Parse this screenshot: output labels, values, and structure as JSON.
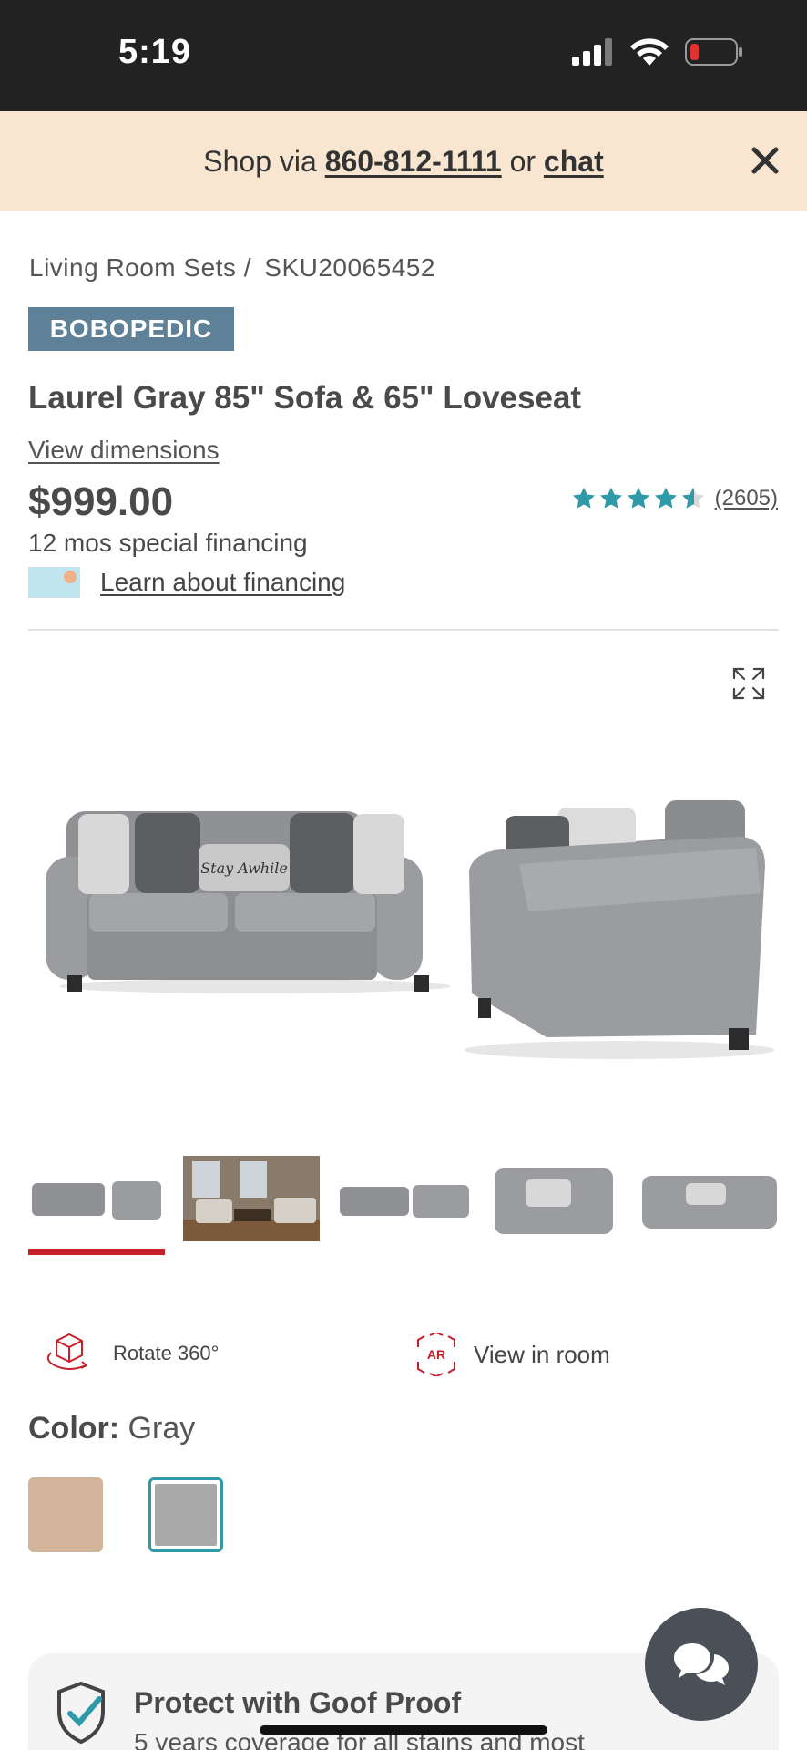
{
  "status_bar": {
    "time": "5:19"
  },
  "promo": {
    "prefix": "Shop via ",
    "phone": "860-812-1111",
    "middle": " or ",
    "chat": "chat"
  },
  "breadcrumb": {
    "category": "Living Room Sets",
    "separator": "/",
    "sku": "SKU20065452"
  },
  "brand": {
    "name": "BOBOPEDIC"
  },
  "product": {
    "title": "Laurel Gray 85\" Sofa & 65\" Loveseat",
    "view_dimensions": "View dimensions",
    "price": "$999.00",
    "rating": 4.5,
    "reviews": "(2605)",
    "financing_text": "12 mos special financing",
    "learn_financing": "Learn about financing"
  },
  "gallery": {
    "thumbnail_count": 5,
    "active_index": 0
  },
  "features": {
    "rotate": "Rotate 360°",
    "view_room": "View in room",
    "ar_badge": "AR"
  },
  "color": {
    "label": "Color:",
    "value": "Gray",
    "swatches": [
      {
        "name": "tan",
        "hex": "#d2b49b"
      },
      {
        "name": "gray",
        "hex": "#a9a9a9",
        "selected": true
      }
    ]
  },
  "protect": {
    "title": "Protect with Goof Proof",
    "subtitle": "5 years coverage for all stains and most"
  },
  "colors": {
    "accent_red": "#c8202a",
    "teal": "#2e9aa8",
    "promo_bg": "#f8e6d0"
  }
}
